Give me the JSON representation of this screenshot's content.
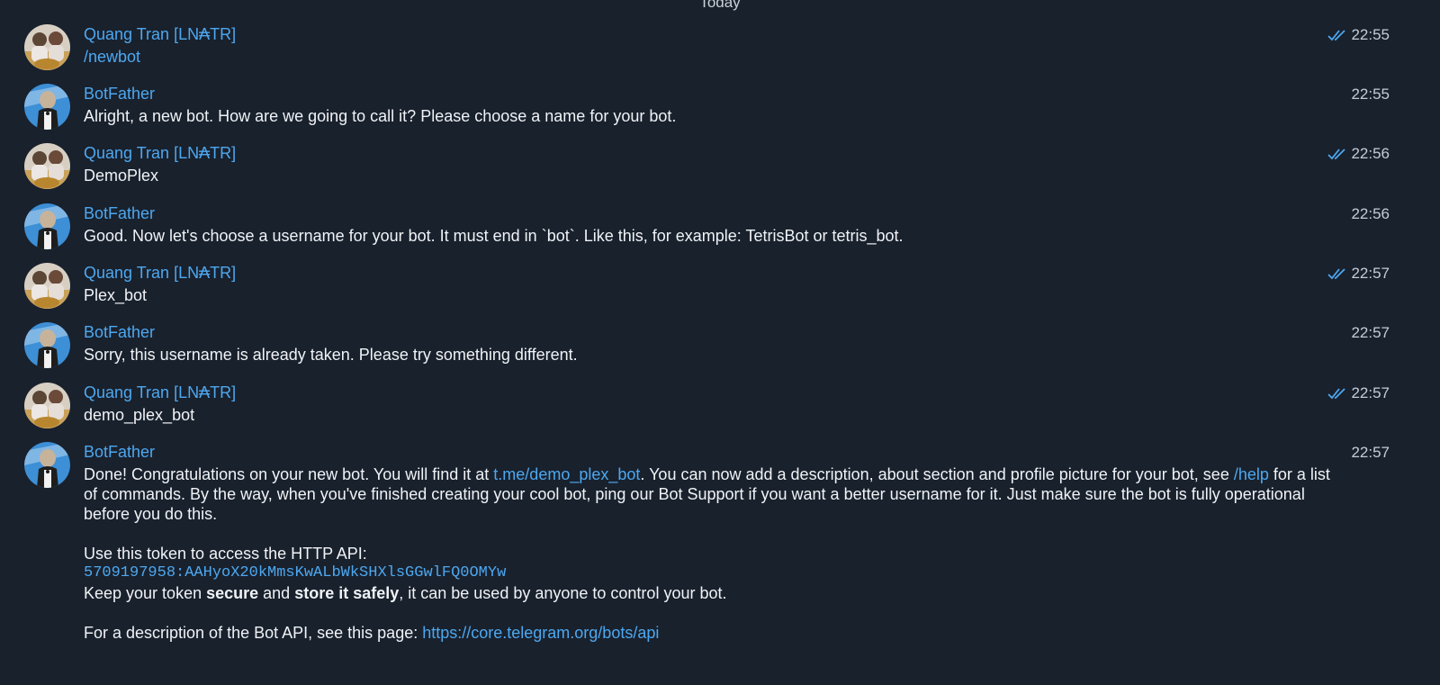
{
  "date_separator": "Today",
  "colors": {
    "background": "#19212d",
    "accent": "#4da8f0",
    "text": "#f0f3f6",
    "muted": "#c4ccd5"
  },
  "messages": [
    {
      "sender": "Quang Tran [LN₳TR]",
      "text": "/newbot",
      "time": "22:55",
      "read": true
    },
    {
      "sender": "BotFather",
      "text": "Alright, a new bot. How are we going to call it? Please choose a name for your bot.",
      "time": "22:55"
    },
    {
      "sender": "Quang Tran [LN₳TR]",
      "text": "DemoPlex",
      "time": "22:56",
      "read": true
    },
    {
      "sender": "BotFather",
      "text": "Good. Now let's choose a username for your bot. It must end in `bot`. Like this, for example: TetrisBot or tetris_bot.",
      "time": "22:56"
    },
    {
      "sender": "Quang Tran [LN₳TR]",
      "text": "Plex_bot",
      "time": "22:57",
      "read": true
    },
    {
      "sender": "BotFather",
      "text": "Sorry, this username is already taken. Please try something different.",
      "time": "22:57"
    },
    {
      "sender": "Quang Tran [LN₳TR]",
      "text": "demo_plex_bot",
      "time": "22:57",
      "read": true
    },
    {
      "sender": "BotFather",
      "time": "22:57",
      "done": {
        "part1": "Done! Congratulations on your new bot. You will find it at ",
        "link_bot": "t.me/demo_plex_bot",
        "part2": ". You can now add a description, about section and profile picture for your bot, see ",
        "link_help": "/help",
        "part3": " for a list of commands. By the way, when you've finished creating your cool bot, ping our Bot Support if you want a better username for it. Just make sure the bot is fully operational before you do this.",
        "token_intro": "Use this token to access the HTTP API:",
        "token": "5709197958:AAHyoX20kMmsKwALbWkSHXlsGGwlFQ0OMYw",
        "keep_a": "Keep your token ",
        "keep_b1": "secure",
        "keep_c": " and ",
        "keep_b2": "store it safely",
        "keep_d": ", it can be used by anyone to control your bot.",
        "api_intro": "For a description of the Bot API, see this page: ",
        "api_link": "https://core.telegram.org/bots/api"
      }
    }
  ]
}
